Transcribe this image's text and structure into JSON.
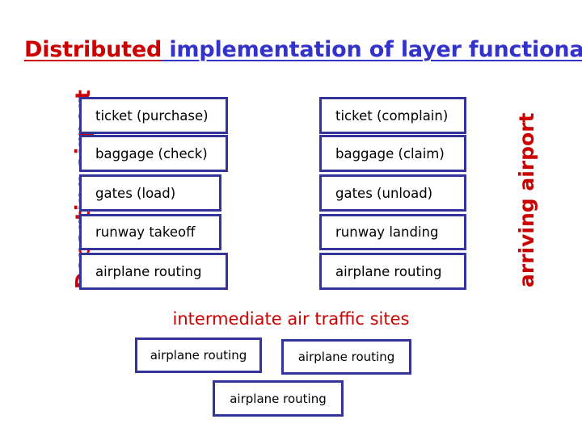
{
  "title": {
    "highlight": "Distributed",
    "rest": " implementation of layer functionality",
    "highlight_color": "#CC0000",
    "rest_color": "#3333CC"
  },
  "side_labels": {
    "left": "Departing airport",
    "right": "arriving airport",
    "color": "#CC0000"
  },
  "colors": {
    "box_border": "#333399",
    "box_text": "#000000",
    "accent_red": "#CC0000",
    "accent_blue": "#3333CC"
  },
  "departing_layers": [
    {
      "label": "ticket (purchase)"
    },
    {
      "label": "baggage (check)"
    },
    {
      "label": "gates (load)"
    },
    {
      "label": "runway takeoff"
    },
    {
      "label": "airplane routing"
    }
  ],
  "arriving_layers": [
    {
      "label": "ticket (complain)"
    },
    {
      "label": "baggage (claim)"
    },
    {
      "label": "gates (unload)"
    },
    {
      "label": "runway landing"
    },
    {
      "label": "airplane routing"
    }
  ],
  "intermediate": {
    "caption": "intermediate air traffic sites",
    "boxes": [
      {
        "label": "airplane routing"
      },
      {
        "label": "airplane routing"
      },
      {
        "label": "airplane routing"
      }
    ]
  }
}
